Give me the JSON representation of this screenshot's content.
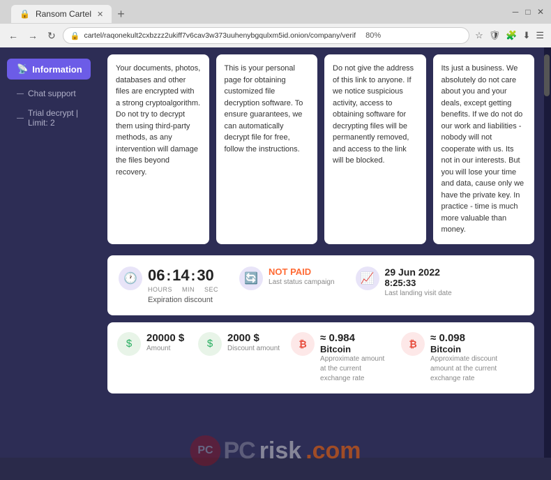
{
  "browser": {
    "tab_title": "Ransom Cartel",
    "tab_favicon": "🔒",
    "address": "cartel/raqonekult2cxbzzz2ukiff7v6cav3w373uuhenybgqulxm5id.onion/company/verif",
    "zoom": "80%",
    "new_tab_symbol": "+",
    "back_symbol": "←",
    "forward_symbol": "→",
    "reload_symbol": "↻"
  },
  "sidebar": {
    "info_label": "Information",
    "info_icon": "📡",
    "chat_label": "Chat support",
    "trial_label": "Trial decrypt | Limit: 2"
  },
  "cards": [
    {
      "text": "Your documents, photos, databases and other files are encrypted with a strong cryptoalgorithm. Do not try to decrypt them using third-party methods, as any intervention will damage the files beyond recovery."
    },
    {
      "text": "This is your personal page for obtaining customized file decryption software. To ensure guarantees, we can automatically decrypt file for free, follow the instructions."
    },
    {
      "text": "Do not give the address of this link to anyone. If we notice suspicious activity, access to obtaining software for decrypting files will be permanently removed, and access to the link will be blocked."
    },
    {
      "text": "Its just a business. We absolutely do not care about you and your deals, except getting benefits. If we do not do our work and liabilities - nobody will not cooperate with us. Its not in our interests. But you will lose your time and data, cause only we have the private key. In practice - time is much more valuable than money."
    }
  ],
  "status": {
    "timer": {
      "hours": "06",
      "min": "14",
      "sec": "30",
      "hours_label": "HOURS",
      "min_label": "MIN",
      "sec_label": "SEC",
      "expiry_label": "Expiration discount"
    },
    "payment": {
      "status": "NOT PAID",
      "sub": "Last status campaign"
    },
    "visit": {
      "date": "29 Jun 2022",
      "time": "8:25:33",
      "sub": "Last landing visit date"
    }
  },
  "amounts": [
    {
      "icon_type": "dollar",
      "value": "20000 $",
      "label": "Amount"
    },
    {
      "icon_type": "dollar",
      "value": "2000 $",
      "label": "Discount amount"
    },
    {
      "icon_type": "bitcoin",
      "value": "≈ 0.984",
      "value2": "Bitcoin",
      "label": "Approximate amount at the current exchange rate"
    },
    {
      "icon_type": "bitcoin",
      "value": "≈ 0.098",
      "value2": "Bitcoin",
      "label": "Approximate discount amount at the current exchange rate"
    }
  ],
  "watermark": {
    "logo_text": "PC",
    "text": "risk",
    "com": ".com"
  }
}
